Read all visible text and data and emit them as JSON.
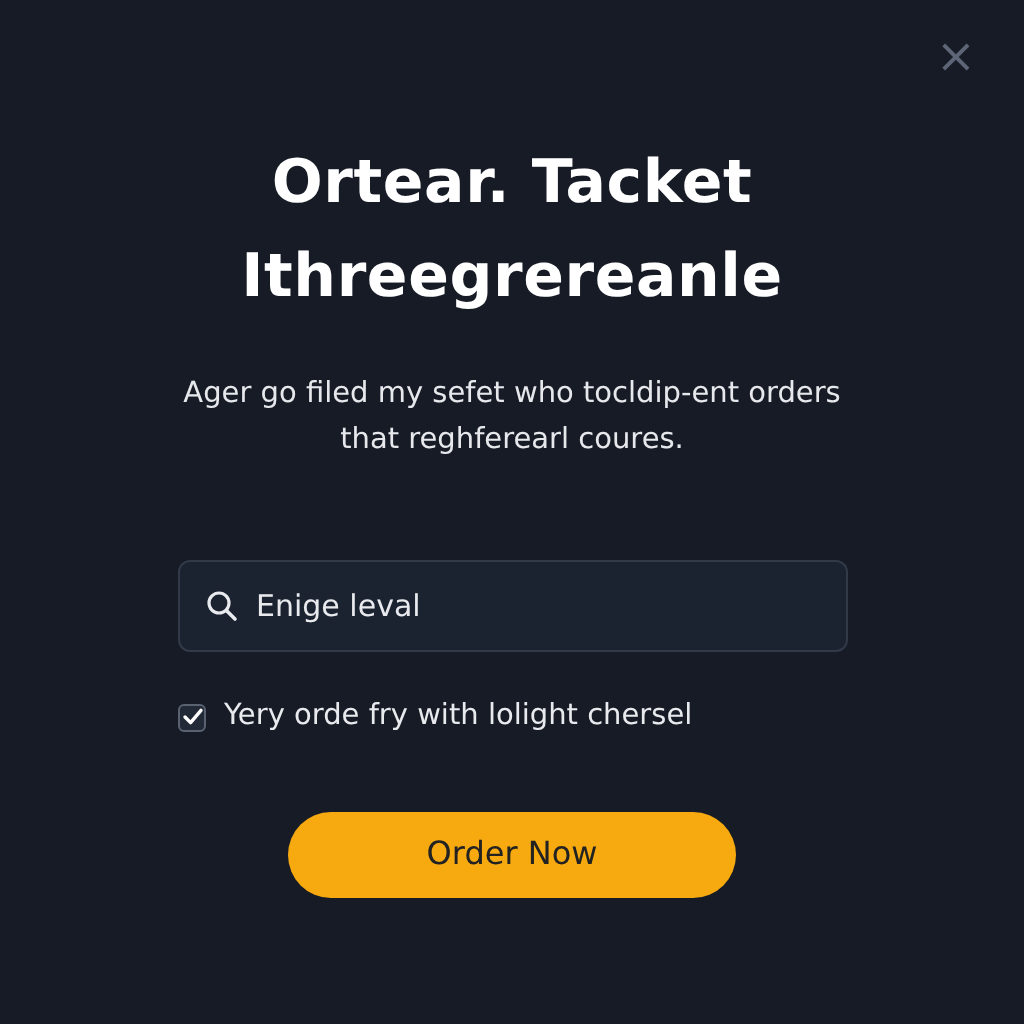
{
  "close_button": {
    "label": "×"
  },
  "title": [
    "Ortear. Tacket",
    "Ithreegrereanle"
  ],
  "description": "Ager go filed my sefet who tocldip-ent orders that reghferearl coures.",
  "search": {
    "value": "Enige leval"
  },
  "checkbox": {
    "label": "Yery orde fry with lolight chersel",
    "checked": true
  },
  "button": {
    "label": "Order Now"
  }
}
